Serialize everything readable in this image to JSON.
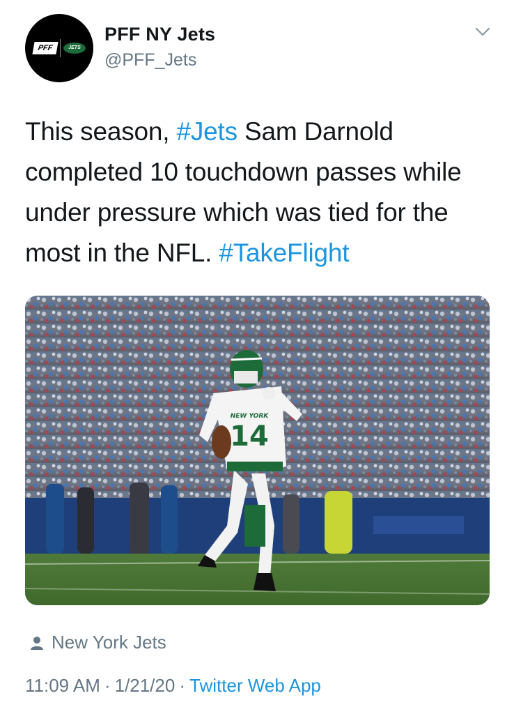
{
  "account": {
    "display_name": "PFF NY Jets",
    "handle": "@PFF_Jets",
    "avatar_logo_left": "PFF",
    "avatar_logo_right": "JETS"
  },
  "tweet": {
    "text_part1": "This season, ",
    "hashtag1": "#Jets",
    "text_part2": " Sam Darnold completed 10 touchdown passes while under pressure which was tied for the most in the NFL. ",
    "hashtag2": "#TakeFlight"
  },
  "media": {
    "jersey_number": "14",
    "jersey_text": "NEW YORK"
  },
  "footer": {
    "tagged_user": "New York Jets",
    "time": "11:09 AM",
    "date": "1/21/20",
    "separator": "·",
    "source": "Twitter Web App"
  },
  "colors": {
    "text": "#14171a",
    "secondary": "#657786",
    "link": "#1b95e0",
    "jets_green": "#1e6b3a"
  },
  "icons": {
    "menu": "chevron-down-icon",
    "tagged": "person-icon"
  }
}
